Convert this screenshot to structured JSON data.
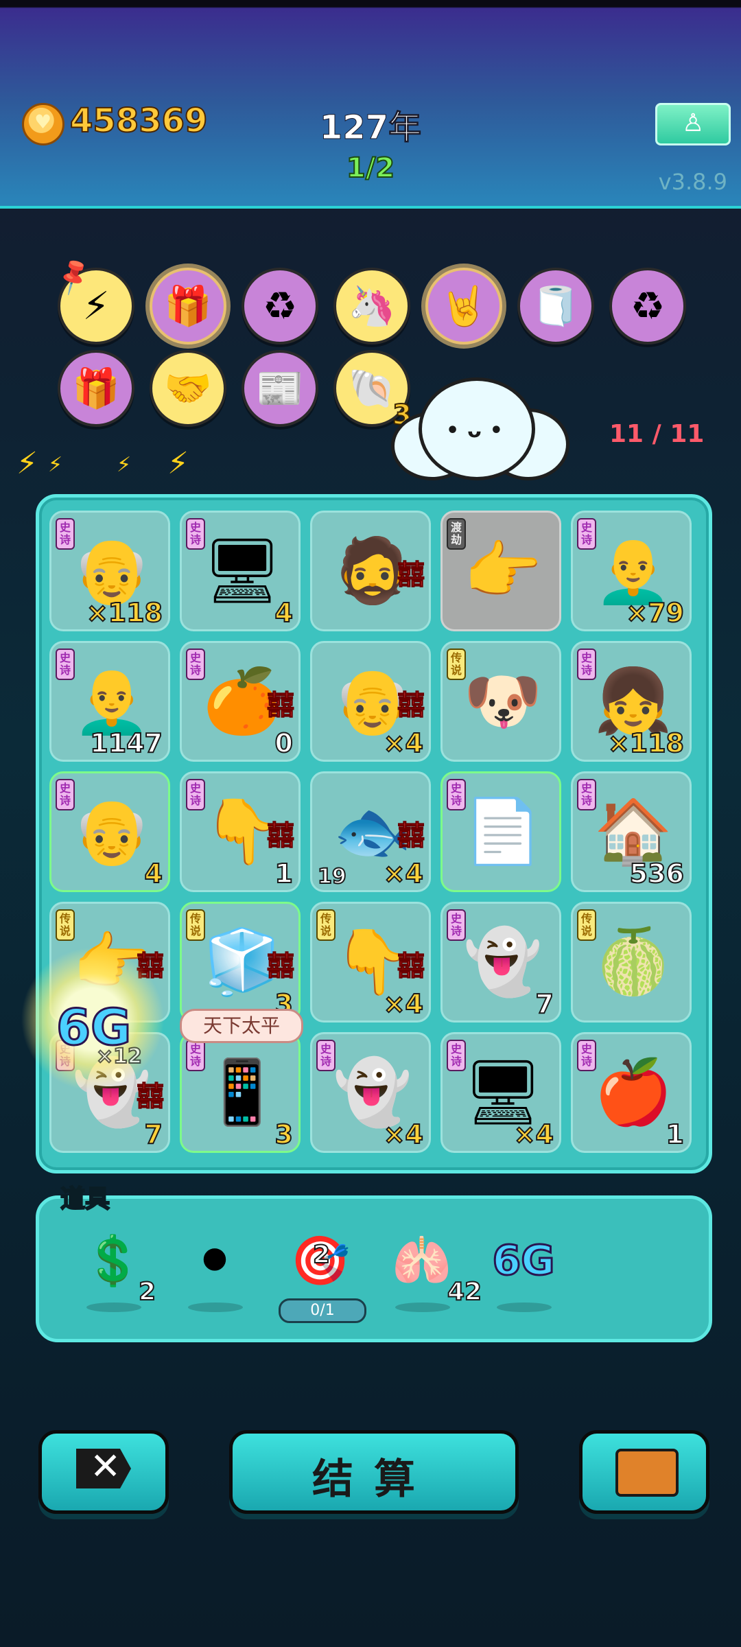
{
  "header": {
    "coins": "458369",
    "year": "127年",
    "wave": "1/2",
    "version": "v3.8.9",
    "meditate_icon": "meditation-icon"
  },
  "skills": [
    {
      "icon": "lightning-icon",
      "glyph": "⚡",
      "bg": "yellow"
    },
    {
      "icon": "gift-box-icon",
      "glyph": "🎁",
      "bg": "purple",
      "gold": true
    },
    {
      "icon": "recycle-icon",
      "glyph": "♻",
      "bg": "purple"
    },
    {
      "icon": "unicorn-icon",
      "glyph": "🦄",
      "bg": "yellow"
    },
    {
      "icon": "rock-hand-icon",
      "glyph": "🤘",
      "bg": "purple",
      "gold": true
    },
    {
      "icon": "tissue-box-icon",
      "glyph": "🧻",
      "bg": "purple"
    },
    {
      "icon": "recycle-icon",
      "glyph": "♻",
      "bg": "purple"
    },
    {
      "icon": "gift-box-icon",
      "glyph": "🎁",
      "bg": "purple"
    },
    {
      "icon": "handshake-icon",
      "glyph": "🤝",
      "bg": "yellow"
    },
    {
      "icon": "time-magazine-icon",
      "glyph": "📰",
      "bg": "purple"
    },
    {
      "icon": "shell-icon",
      "glyph": "🐚",
      "bg": "yellow",
      "count": "3"
    }
  ],
  "energy_counter": "11 / 11",
  "tiles": [
    {
      "tag": "史诗",
      "tag_type": "epic",
      "icon": "green-hat-man-icon",
      "glyph": "👴",
      "count": "×118",
      "count_style": "yellow"
    },
    {
      "tag": "史诗",
      "tag_type": "epic",
      "icon": "graphics-card-icon",
      "glyph": "🖥",
      "count": "4",
      "count_style": "yellow"
    },
    {
      "icon": "man-face-icon",
      "glyph": "🧔",
      "xi": "囍"
    },
    {
      "tag": "渡劫",
      "tag_type": "dujie",
      "icon": "pointing-hand-icon",
      "glyph": "👉",
      "gray": true
    },
    {
      "tag": "史诗",
      "tag_type": "epic",
      "icon": "bald-man-glasses-icon",
      "glyph": "👨‍🦲",
      "count": "×79",
      "count_style": "yellow"
    },
    {
      "tag": "史诗",
      "tag_type": "epic",
      "icon": "bald-man-icon",
      "glyph": "👨‍🦲",
      "count": "1147",
      "count_style": "white"
    },
    {
      "tag": "史诗",
      "tag_type": "epic",
      "icon": "orange-icon",
      "glyph": "🍊",
      "count": "0",
      "count_style": "white",
      "xi": "囍"
    },
    {
      "icon": "old-man-glasses-icon",
      "glyph": "👴",
      "count": "×4",
      "count_style": "yellow",
      "xi": "囍"
    },
    {
      "tag": "传说",
      "tag_type": "legend",
      "icon": "crowned-dog-icon",
      "glyph": "🐶"
    },
    {
      "tag": "史诗",
      "tag_type": "epic",
      "icon": "girl-braids-icon",
      "glyph": "👧",
      "count": "×118",
      "count_style": "yellow"
    },
    {
      "tag": "史诗",
      "tag_type": "epic",
      "icon": "green-hat-man-icon",
      "glyph": "👴",
      "count": "4",
      "count_style": "yellow",
      "green": true
    },
    {
      "tag": "史诗",
      "tag_type": "epic",
      "icon": "gray-pointing-hand-icon",
      "glyph": "👇",
      "count": "1",
      "count_style": "white",
      "xi": "囍"
    },
    {
      "icon": "fish-icon",
      "glyph": "🐟",
      "count": "×4",
      "count_style": "yellow",
      "left_count": "19",
      "xi": "囍"
    },
    {
      "tag": "史诗",
      "tag_type": "epic",
      "icon": "copy-paste-icon",
      "glyph": "📄",
      "green": true
    },
    {
      "tag": "史诗",
      "tag_type": "epic",
      "icon": "rabbit-house-icon",
      "glyph": "🏠",
      "count": "536",
      "count_style": "white"
    },
    {
      "tag": "传说",
      "tag_type": "legend",
      "icon": "pointing-hand-icon",
      "glyph": "👉",
      "xi": "囍"
    },
    {
      "tag": "传说",
      "tag_type": "legend",
      "icon": "fridge-icon",
      "glyph": "🧊",
      "count": "3",
      "count_style": "yellow",
      "green": true,
      "xi": "囍"
    },
    {
      "tag": "传说",
      "tag_type": "legend",
      "icon": "crowned-hand-icon",
      "glyph": "👇",
      "count": "×4",
      "count_style": "yellow",
      "xi": "囍"
    },
    {
      "tag": "史诗",
      "tag_type": "epic",
      "icon": "ghost-medal-icon",
      "glyph": "👻",
      "count": "7",
      "count_style": "white"
    },
    {
      "tag": "传说",
      "tag_type": "legend",
      "icon": "longan-icon",
      "glyph": "🍈"
    },
    {
      "tag": "史诗",
      "tag_type": "epic",
      "icon": "ghost-icon",
      "glyph": "👻",
      "count": "7",
      "count_style": "yellow",
      "xi": "囍"
    },
    {
      "tag": "史诗",
      "tag_type": "epic",
      "icon": "remote-control-icon",
      "glyph": "📱",
      "count": "3",
      "count_style": "yellow",
      "green": true
    },
    {
      "tag": "史诗",
      "tag_type": "epic",
      "icon": "ghost-icon",
      "glyph": "👻",
      "count": "×4",
      "count_style": "yellow"
    },
    {
      "tag": "史诗",
      "tag_type": "epic",
      "icon": "graphics-card-icon",
      "glyph": "🖥",
      "count": "×4",
      "count_style": "yellow"
    },
    {
      "tag": "史诗",
      "tag_type": "epic",
      "icon": "apple-icon",
      "glyph": "🍎",
      "count": "1",
      "count_style": "white"
    }
  ],
  "effects": {
    "sixg": "6G",
    "bubble": "天下太平",
    "overlay_count": "×12"
  },
  "props": {
    "label": "道具",
    "items": [
      {
        "icon": "dollar-coin-icon",
        "glyph": "💲",
        "count": "2"
      },
      {
        "icon": "black-hole-icon",
        "glyph": "⚫",
        "count": ""
      },
      {
        "icon": "target-icon",
        "glyph": "🎯",
        "count": "2",
        "pill": "0/1"
      },
      {
        "icon": "liver-icon",
        "glyph": "🫁",
        "count": "42"
      },
      {
        "icon": "6g-icon",
        "glyph": "6G",
        "count": ""
      }
    ]
  },
  "buttons": {
    "cancel_icon": "close-icon",
    "settle": "结算",
    "bag_icon": "briefcase-icon"
  }
}
